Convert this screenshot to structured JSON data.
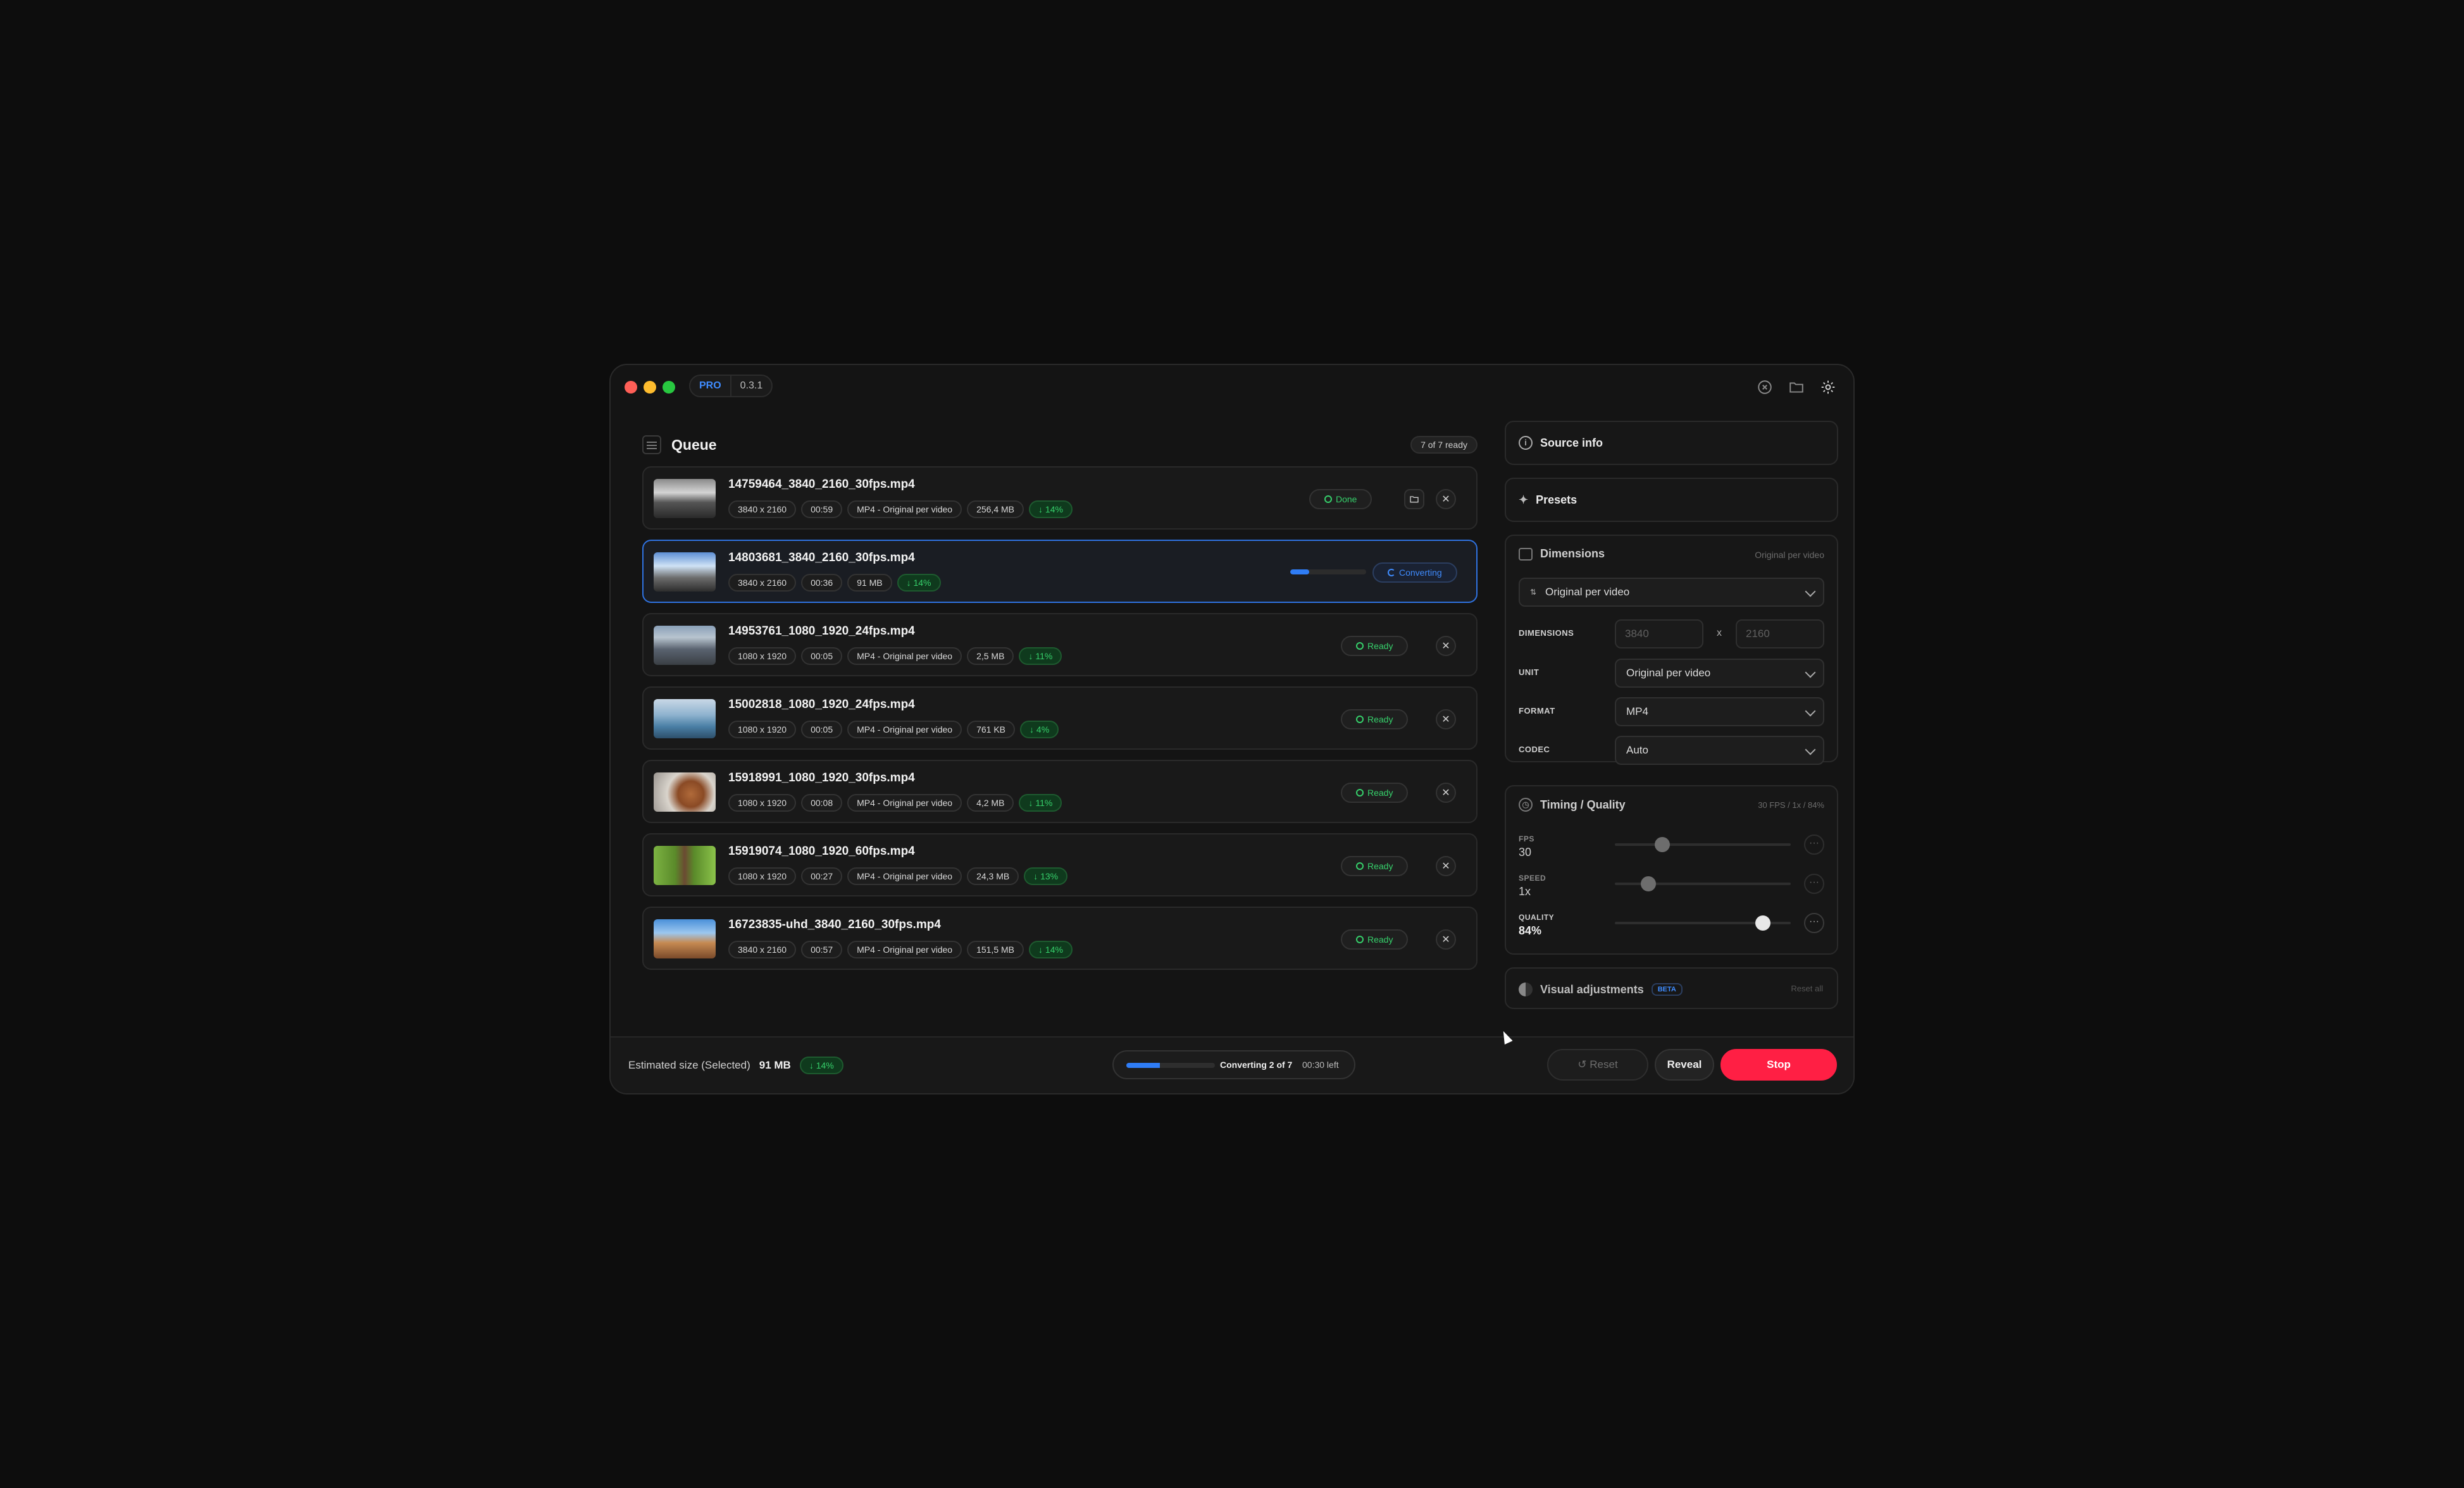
{
  "app": {
    "badge": "PRO",
    "version": "0.3.1"
  },
  "titlebar_icons": [
    "close-circle-icon",
    "folder-icon",
    "gear-icon"
  ],
  "queue": {
    "title": "Queue",
    "ready_count": "7 of 7 ready",
    "items": [
      {
        "name": "14759464_3840_2160_30fps.mp4",
        "dims": "3840 x 2160",
        "duration": "00:59",
        "format": "MP4 - Original per video",
        "size": "256,4 MB",
        "saving": "↓ 14%",
        "status": "Done",
        "progress": 1.0
      },
      {
        "name": "14803681_3840_2160_30fps.mp4",
        "dims": "3840 x 2160",
        "duration": "00:36",
        "format": "",
        "size": "91 MB",
        "saving": "↓ 14%",
        "status": "Converting",
        "progress": 0.25
      },
      {
        "name": "14953761_1080_1920_24fps.mp4",
        "dims": "1080 x 1920",
        "duration": "00:05",
        "format": "MP4 - Original per video",
        "size": "2,5 MB",
        "saving": "↓ 11%",
        "status": "Ready"
      },
      {
        "name": "15002818_1080_1920_24fps.mp4",
        "dims": "1080 x 1920",
        "duration": "00:05",
        "format": "MP4 - Original per video",
        "size": "761 KB",
        "saving": "↓ 4%",
        "status": "Ready"
      },
      {
        "name": "15918991_1080_1920_30fps.mp4",
        "dims": "1080 x 1920",
        "duration": "00:08",
        "format": "MP4 - Original per video",
        "size": "4,2 MB",
        "saving": "↓ 11%",
        "status": "Ready"
      },
      {
        "name": "15919074_1080_1920_60fps.mp4",
        "dims": "1080 x 1920",
        "duration": "00:27",
        "format": "MP4 - Original per video",
        "size": "24,3 MB",
        "saving": "↓ 13%",
        "status": "Ready"
      },
      {
        "name": "16723835-uhd_3840_2160_30fps.mp4",
        "dims": "3840 x 2160",
        "duration": "00:57",
        "format": "MP4 - Original per video",
        "size": "151,5 MB",
        "saving": "↓ 14%",
        "status": "Ready"
      }
    ]
  },
  "panel": {
    "source_info": "Source info",
    "presets": "Presets",
    "dimensions": {
      "title": "Dimensions",
      "right_note": "Original per video",
      "preset_select": "Original per video",
      "dims_label": "DIMENSIONS",
      "width_placeholder": "3840",
      "height_placeholder": "2160",
      "x": "x",
      "unit_label": "UNIT",
      "unit_value": "Original per video",
      "format_label": "FORMAT",
      "format_value": "MP4",
      "codec_label": "CODEC",
      "codec_value": "Auto"
    },
    "timing": {
      "title": "Timing / Quality",
      "summary": "30 FPS / 1x / 84%",
      "fps_label": "FPS",
      "fps_value": "30",
      "fps_level": 0.27,
      "speed_label": "SPEED",
      "speed_value": "1x",
      "speed_level": 0.19,
      "quality_label": "QUALITY",
      "quality_value": "84%",
      "quality_level": 0.84
    },
    "visual": {
      "title": "Visual adjustments",
      "beta": "BETA",
      "reset_all": "Reset all"
    }
  },
  "footer": {
    "estimated_label": "Estimated size (Selected)",
    "estimated_value": "91 MB",
    "estimated_saving": "↓ 14%",
    "converting": "Converting 2 of 7",
    "time_left": "00:30 left",
    "overall_progress": 0.38,
    "reset": "Reset",
    "reveal": "Reveal",
    "stop": "Stop"
  },
  "colors": {
    "accent_blue": "#2f7df6",
    "success_green": "#36d06b",
    "stop_red": "#ff1f44"
  }
}
